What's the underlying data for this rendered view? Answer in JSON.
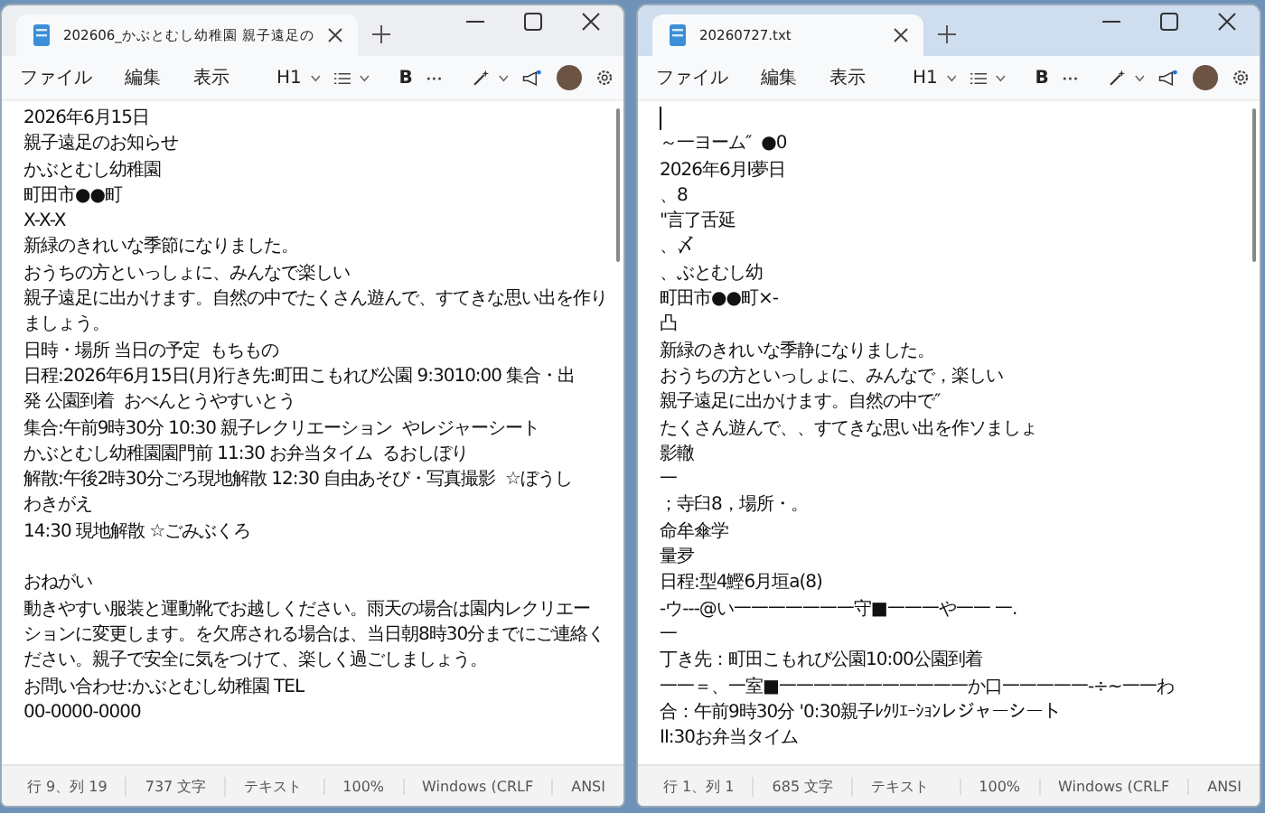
{
  "windows": [
    {
      "focused": false,
      "tab_title": "202606_かぶとむし幼稚園 親子遠足の",
      "menu": [
        "ファイル",
        "編集",
        "表示"
      ],
      "heading_button": "H1",
      "bold_button": "B",
      "paragraphs": [
        [
          "2026年6月15日",
          "親子遠足のお知らせ",
          "かぶとむし幼稚園",
          "町田市●●町",
          "X-X-X",
          "新緑のきれいな季節になりました。",
          "おうちの方といっしょに、みんなで楽しい",
          "親子遠足に出かけます。自然の中でたくさん遊んで、すてきな思い出を作り",
          "ましょう。",
          "日時・場所 当日の予定  もちもの",
          "日程:2026年6月15日(月)行き先:町田こもれび公園 9:3010:00 集合・出",
          "発 公園到着  おべんとうやすいとう",
          "集合:午前9時30分 10:30 親子レクリエーション  やレジャーシート",
          "かぶとむし幼稚園園門前 11:30 お弁当タイム  るおしぼり",
          "解散:午後2時30分ごろ現地解散 12:30 自由あそび・写真撮影  ☆ぼうし",
          "わきがえ",
          "14:30 現地解散 ☆ごみぶくろ"
        ],
        [
          "おねがい",
          "動きやすい服装と運動靴でお越しください。雨天の場合は園内レクリエー",
          "ションに変更します。を欠席される場合は、当日朝8時30分までにご連絡く",
          "ださい。親子で安全に気をつけて、楽しく過ごしましょう。",
          "お問い合わせ:かぶとむし幼稚園 TEL",
          "00-0000-0000"
        ]
      ],
      "status": [
        "行 9、列 19",
        "737 文字",
        "テキスト",
        "100%",
        "Windows (CRLF",
        "ANSI"
      ]
    },
    {
      "focused": true,
      "tab_title": "20260727.txt",
      "menu": [
        "ファイル",
        "編集",
        "表示"
      ],
      "heading_button": "H1",
      "bold_button": "B",
      "paragraphs": [
        [
          "～一ヨーム″  ●0",
          "2026年6月l夢日",
          "、8",
          "\"言了舌延",
          "、〆",
          "、ぶとむし幼",
          "町田市●●町×-",
          "凸",
          "新緑のきれいな季静になりました。",
          "おうちの方といっしょに、みんなで，楽しい",
          "親子遠足に出かけます。自然の中で″",
          "たくさん遊んで、、すてきな思い出を作ソましょ",
          "影轍",
          "一",
          "；寺臼8，場所・。",
          "命牟傘学",
          "量夛",
          "日程:型4鰹6月垣a(8)",
          "-ウ---@い一一一一一一一守■一一一や一一 一.",
          "一",
          "丁き先：町田こもれび公園10:00公園到着",
          "一一＝、一室■一一一一一一一一一一一か口一一一一一-÷~一一わ",
          "合：午前9時30分 '0:30親子ﾚｸﾘｴｰｼｮﾝレジャーシート",
          "II:30お弁当タイム"
        ]
      ],
      "status": [
        "行 1、列 1",
        "685 文字",
        "テキスト",
        "100%",
        "Windows (CRLF",
        "ANSI"
      ]
    }
  ]
}
